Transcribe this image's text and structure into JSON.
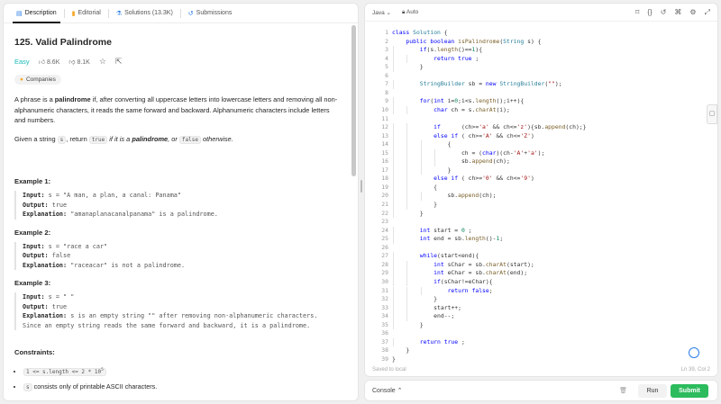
{
  "tabs": {
    "description": "Description",
    "editorial": "Editorial",
    "solutions": "Solutions (13.3K)",
    "submissions": "Submissions"
  },
  "problem": {
    "title": "125. Valid Palindrome",
    "difficulty": "Easy",
    "likes": "8.6K",
    "dislikes": "8.1K",
    "companies": "Companies",
    "desc1_a": "A phrase is a ",
    "desc1_b": "palindrome",
    "desc1_c": " if, after converting all uppercase letters into lowercase letters and removing all non-alphanumeric characters, it reads the same forward and backward. Alphanumeric characters include letters and numbers.",
    "desc2_a": "Given a string ",
    "desc2_s": "s",
    "desc2_b": ", return ",
    "desc2_true": "true",
    "desc2_c": " if it is a ",
    "desc2_d": "palindrome",
    "desc2_e": ", or ",
    "desc2_false": "false",
    "desc2_f": " otherwise."
  },
  "examples": [
    {
      "heading": "Example 1:",
      "input": "s = \"A man, a plan, a canal: Panama\"",
      "output": "true",
      "explanation": "\"amanaplanacanalpanama\" is a palindrome."
    },
    {
      "heading": "Example 2:",
      "input": "s = \"race a car\"",
      "output": "false",
      "explanation": "\"raceacar\" is not a palindrome."
    },
    {
      "heading": "Example 3:",
      "input": "s = \" \"",
      "output": "true",
      "explanation": "s is an empty string \"\" after removing non-alphanumeric characters.",
      "explanation2": "Since an empty string reads the same forward and backward, it is a palindrome."
    }
  ],
  "labels": {
    "input": "Input:",
    "output": "Output:",
    "explanation": "Explanation:"
  },
  "constraints": {
    "heading": "Constraints:",
    "c1": "1 <= s.length <= 2 * 10",
    "c1_exp": "5",
    "c2_code": "s",
    "c2_text": " consists only of printable ASCII characters."
  },
  "editor": {
    "language": "Java",
    "mode": "Auto",
    "saved": "Saved to local",
    "position": "Ln 39, Col 2"
  },
  "code_lines": [
    "class Solution {",
    "    public boolean isPalindrome(String s) {",
    "        if(s.length()==1){",
    "            return true ;",
    "        }",
    "",
    "        StringBuilder sb = new StringBuilder(\"\");",
    "",
    "        for(int i=0;i<s.length();i++){",
    "            char ch = s.charAt(i);",
    "",
    "            if      (ch>='a' && ch<='z'){sb.append(ch);}",
    "            else if ( ch>='A' && ch<='Z')",
    "                {",
    "                    ch = (char)(ch-'A'+'a');",
    "                    sb.append(ch);",
    "                }",
    "            else if ( ch>='0' && ch<='9')",
    "            {",
    "                sb.append(ch);",
    "            }",
    "        }",
    "",
    "        int start = 0 ;",
    "        int end = sb.length()-1;",
    "",
    "        while(start<end){",
    "            int sChar = sb.charAt(start);",
    "            int eChar = sb.charAt(end);",
    "            if(sChar!=eChar){",
    "                return false;",
    "            }",
    "            start++;",
    "            end--;",
    "        }",
    "",
    "        return true ;",
    "    }",
    "}"
  ],
  "console": {
    "label": "Console",
    "run": "Run",
    "submit": "Submit"
  }
}
